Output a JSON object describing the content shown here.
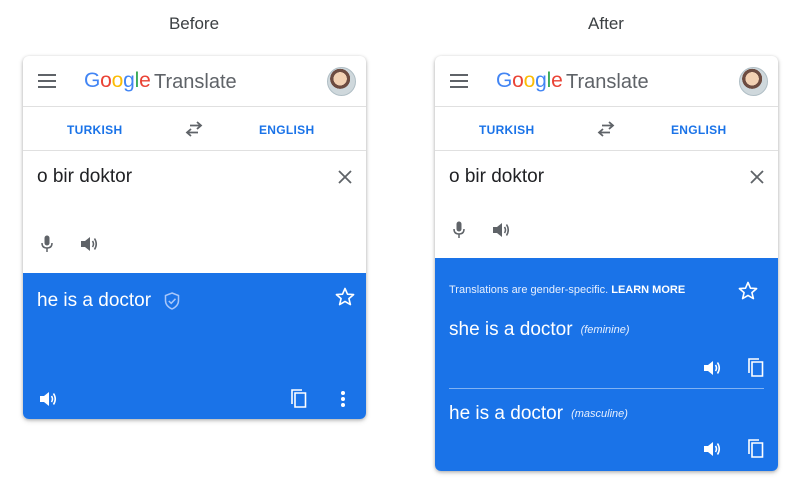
{
  "captions": {
    "before": "Before",
    "after": "After"
  },
  "app": {
    "logo_letters": [
      "G",
      "o",
      "o",
      "g",
      "l",
      "e"
    ],
    "title": "Translate",
    "source_lang": "TURKISH",
    "target_lang": "ENGLISH",
    "source_text": "o bir doktor"
  },
  "before": {
    "translation": "he is a doctor"
  },
  "after": {
    "notice_text": "Translations are gender-specific.",
    "notice_link": "LEARN MORE",
    "translations": [
      {
        "text": "she is a doctor",
        "gender": "(feminine)"
      },
      {
        "text": "he is a doctor",
        "gender": "(masculine)"
      }
    ]
  },
  "colors": {
    "accent": "#1a73e8",
    "text": "#202124",
    "icon": "#5f6368"
  }
}
